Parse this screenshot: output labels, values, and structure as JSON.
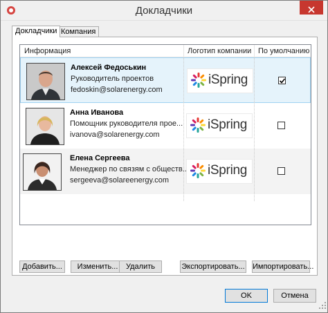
{
  "window": {
    "title": "Докладчики"
  },
  "tabs": [
    {
      "label": "Докладчики"
    },
    {
      "label": "Компания"
    }
  ],
  "list": {
    "columns": [
      "Информация",
      "Логотип компании",
      "По умолчанию"
    ],
    "rows": [
      {
        "name": "Алексей Федоськин",
        "job": "Руководитель проектов",
        "email": "fedoskin@solarenergy.com",
        "logo": "iSpring",
        "default": true
      },
      {
        "name": "Анна Иванова",
        "job": "Помощник руководителя прое...",
        "email": "ivanova@solarenergy.com",
        "logo": "iSpring",
        "default": false
      },
      {
        "name": "Елена Сергеева",
        "job": "Менеджер по связям с обществ...",
        "email": "sergeeva@solareenergy.com",
        "logo": "iSpring",
        "default": false
      }
    ]
  },
  "actions": {
    "add": "Добавить...",
    "edit": "Изменить...",
    "delete": "Удалить",
    "export": "Экспортировать...",
    "import": "Импортировать..."
  },
  "footer": {
    "ok": "OK",
    "cancel": "Отмена"
  },
  "colors": {
    "close": "#c7372f",
    "selection": "#e5f3fb",
    "selection_border": "#9fd1f1",
    "accent": "#0078d7"
  },
  "icons": [
    "app-icon",
    "close-icon",
    "check-icon",
    "ispring-logo-icon",
    "resize-grip-icon"
  ]
}
